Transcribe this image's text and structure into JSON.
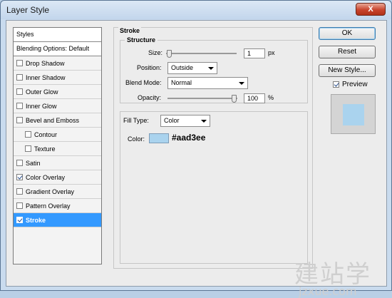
{
  "window": {
    "title": "Layer Style",
    "close_label": "X"
  },
  "styles_panel": {
    "header": "Styles",
    "blending_options": "Blending Options: Default",
    "items": [
      {
        "label": "Drop Shadow",
        "checked": false,
        "sub": false,
        "selected": false
      },
      {
        "label": "Inner Shadow",
        "checked": false,
        "sub": false,
        "selected": false
      },
      {
        "label": "Outer Glow",
        "checked": false,
        "sub": false,
        "selected": false
      },
      {
        "label": "Inner Glow",
        "checked": false,
        "sub": false,
        "selected": false
      },
      {
        "label": "Bevel and Emboss",
        "checked": false,
        "sub": false,
        "selected": false
      },
      {
        "label": "Contour",
        "checked": false,
        "sub": true,
        "selected": false
      },
      {
        "label": "Texture",
        "checked": false,
        "sub": true,
        "selected": false
      },
      {
        "label": "Satin",
        "checked": false,
        "sub": false,
        "selected": false
      },
      {
        "label": "Color Overlay",
        "checked": true,
        "sub": false,
        "selected": false
      },
      {
        "label": "Gradient Overlay",
        "checked": false,
        "sub": false,
        "selected": false
      },
      {
        "label": "Pattern Overlay",
        "checked": false,
        "sub": false,
        "selected": false
      },
      {
        "label": "Stroke",
        "checked": true,
        "sub": false,
        "selected": true
      }
    ]
  },
  "stroke": {
    "panel_title": "Stroke",
    "structure_title": "Structure",
    "size_label": "Size:",
    "size_value": "1",
    "size_unit": "px",
    "size_slider_fraction": 0.0,
    "position_label": "Position:",
    "position_value": "Outside",
    "blend_mode_label": "Blend Mode:",
    "blend_mode_value": "Normal",
    "opacity_label": "Opacity:",
    "opacity_value": "100",
    "opacity_unit": "%",
    "opacity_slider_fraction": 1.0,
    "fill_type_label": "Fill Type:",
    "fill_type_value": "Color",
    "color_label": "Color:",
    "color_hex_text": "#aad3ee",
    "color_swatch": "#aad3ee"
  },
  "buttons": {
    "ok": "OK",
    "reset": "Reset",
    "new_style": "New Style...",
    "preview": "Preview",
    "preview_checked": true
  },
  "watermark": {
    "cn": "建站学",
    "en": "jzxue.com"
  },
  "colors": {
    "selection": "#3399ff",
    "stroke_color": "#aad3ee",
    "close_button": "#c8442d"
  }
}
